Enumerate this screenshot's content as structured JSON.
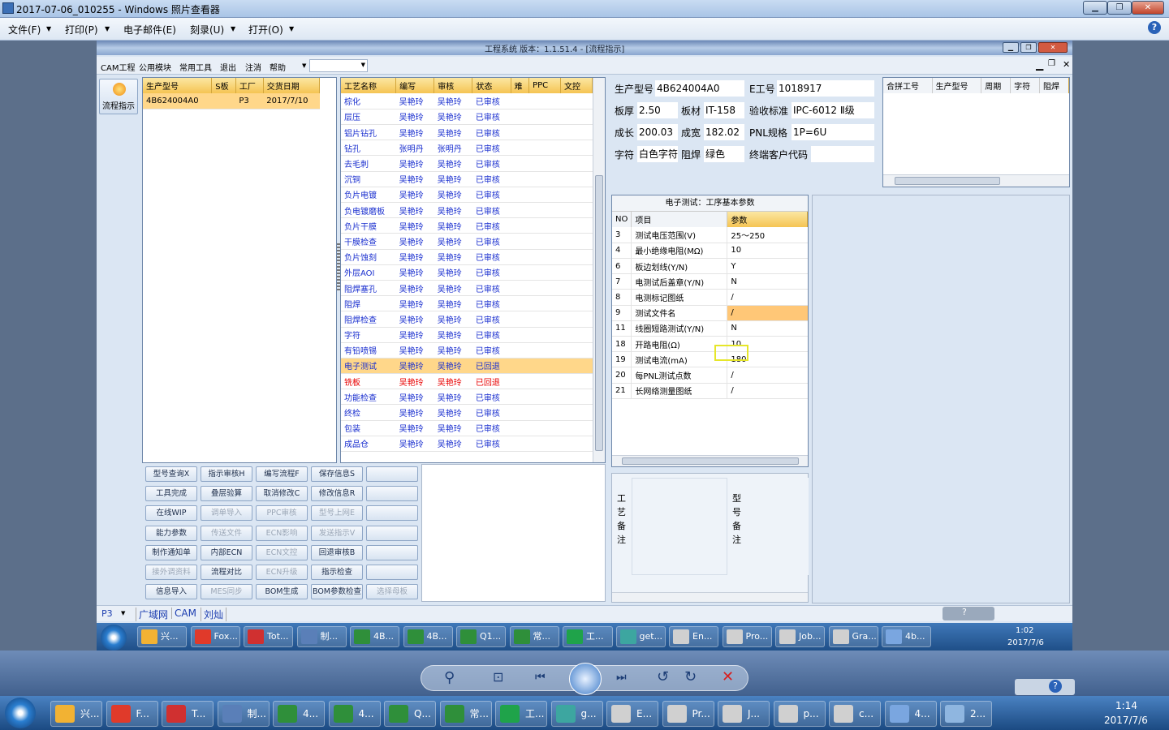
{
  "viewer": {
    "title": "2017-07-06_010255 - Windows 照片查看器",
    "menu": [
      "文件(F)",
      "打印(P)",
      "电子邮件(E)",
      "刻录(U)",
      "打开(O)"
    ]
  },
  "app": {
    "title": "工程系统   版本：1.1.51.4 - [流程指示]",
    "menu": [
      "CAM工程",
      "公用模块",
      "常用工具",
      "退出",
      "注消",
      "帮助"
    ],
    "side_button": "流程指示",
    "orders": {
      "headers": [
        "生产型号",
        "S板",
        "工厂",
        "交货日期"
      ],
      "rows": [
        [
          "4B624004A0",
          "",
          "P3",
          "2017/7/10"
        ]
      ]
    },
    "process": {
      "headers": [
        "工艺名称",
        "编写",
        "审核",
        "状态",
        "难",
        "PPC",
        "文控"
      ],
      "rows": [
        [
          "棕化",
          "吴艳玲",
          "吴艳玲",
          "已审核"
        ],
        [
          "层压",
          "吴艳玲",
          "吴艳玲",
          "已审核"
        ],
        [
          "铝片钻孔",
          "吴艳玲",
          "吴艳玲",
          "已审核"
        ],
        [
          "钻孔",
          "张明丹",
          "张明丹",
          "已审核"
        ],
        [
          "去毛刺",
          "吴艳玲",
          "吴艳玲",
          "已审核"
        ],
        [
          "沉铜",
          "吴艳玲",
          "吴艳玲",
          "已审核"
        ],
        [
          "负片电镀",
          "吴艳玲",
          "吴艳玲",
          "已审核"
        ],
        [
          "负电镀磨板",
          "吴艳玲",
          "吴艳玲",
          "已审核"
        ],
        [
          "负片干膜",
          "吴艳玲",
          "吴艳玲",
          "已审核"
        ],
        [
          "干膜检查",
          "吴艳玲",
          "吴艳玲",
          "已审核"
        ],
        [
          "负片蚀刻",
          "吴艳玲",
          "吴艳玲",
          "已审核"
        ],
        [
          "外层AOI",
          "吴艳玲",
          "吴艳玲",
          "已审核"
        ],
        [
          "阻焊塞孔",
          "吴艳玲",
          "吴艳玲",
          "已审核"
        ],
        [
          "阻焊",
          "吴艳玲",
          "吴艳玲",
          "已审核"
        ],
        [
          "阻焊检查",
          "吴艳玲",
          "吴艳玲",
          "已审核"
        ],
        [
          "字符",
          "吴艳玲",
          "吴艳玲",
          "已审核"
        ],
        [
          "有铅喷锡",
          "吴艳玲",
          "吴艳玲",
          "已审核"
        ],
        [
          "电子测试",
          "吴艳玲",
          "吴艳玲",
          "已回退"
        ],
        [
          "铣板",
          "吴艳玲",
          "吴艳玲",
          "已回退"
        ],
        [
          "功能检查",
          "吴艳玲",
          "吴艳玲",
          "已审核"
        ],
        [
          "终检",
          "吴艳玲",
          "吴艳玲",
          "已审核"
        ],
        [
          "包装",
          "吴艳玲",
          "吴艳玲",
          "已审核"
        ],
        [
          "成品仓",
          "吴艳玲",
          "吴艳玲",
          "已审核"
        ]
      ]
    },
    "buttons": [
      [
        "型号查询X",
        "指示审核H",
        "编写流程F",
        "保存信息S",
        ""
      ],
      [
        "工具完成",
        "叠层验算",
        "取消修改C",
        "修改信息R",
        ""
      ],
      [
        "在线WIP",
        "调单导入",
        "PPC审核",
        "型号上网E",
        ""
      ],
      [
        "能力参数",
        "传送文件",
        "ECN影响",
        "发送指示V",
        ""
      ],
      [
        "制作通知单",
        "内部ECN",
        "ECN文控",
        "回退审核B",
        ""
      ],
      [
        "接外调资料",
        "流程对比",
        "ECN升级",
        "指示检查",
        ""
      ],
      [
        "信息导入",
        "MES同步",
        "BOM生成",
        "BOM参数检查",
        "选择母板"
      ]
    ],
    "info": {
      "prod_model_label": "生产型号",
      "prod_model": "4B624004A0",
      "eno_label": "E工号",
      "eno": "1018917",
      "thick_label": "板厚",
      "thick": "2.50",
      "mat_label": "板材",
      "mat": "IT-158",
      "std_label": "验收标准",
      "std": "IPC-6012 Ⅱ级",
      "len_label": "成长",
      "len": "200.03",
      "wid_label": "成宽",
      "wid": "182.02",
      "pnl_label": "PNL规格",
      "pnl": "1P=6U",
      "char_label": "字符",
      "char": "白色字符",
      "mask_label": "阻焊",
      "mask": "绿色",
      "cust_label": "终端客户代码",
      "cust": ""
    },
    "merge": {
      "headers": [
        "合拼工号",
        "生产型号",
        "周期",
        "字符",
        "阻焊"
      ]
    },
    "params": {
      "title": "电子测试：工序基本参数",
      "headers": [
        "NO",
        "项目",
        "参数"
      ],
      "rows": [
        [
          "3",
          "测试电压范围(V)",
          "25～250"
        ],
        [
          "4",
          "最小绝缘电阻(MΩ)",
          "10"
        ],
        [
          "6",
          "板边划线(Y/N)",
          "Y"
        ],
        [
          "7",
          "电测试后盖章(Y/N)",
          "N"
        ],
        [
          "8",
          "电测标记图纸",
          "/"
        ],
        [
          "9",
          "测试文件名",
          "/"
        ],
        [
          "11",
          "线圈短路测试(Y/N)",
          "N"
        ],
        [
          "18",
          "开路电阻(Ω)",
          "10"
        ],
        [
          "19",
          "测试电流(mA)",
          "180"
        ],
        [
          "20",
          "每PNL测试点数",
          "/"
        ],
        [
          "21",
          "长网络测量图纸",
          "/"
        ]
      ]
    },
    "notes": {
      "craft": "工艺备注",
      "model": "型号备注"
    },
    "status": {
      "factory": "P3",
      "tabs": [
        "广域网",
        "CAM",
        "刘灿"
      ]
    }
  },
  "taskbar_inner": {
    "items": [
      "兴...",
      "Fox...",
      "Tot...",
      "制...",
      "4B...",
      "4B...",
      "Q1...",
      "常...",
      "工...",
      "get...",
      "En...",
      "Pro...",
      "Job...",
      "Gra...",
      "4b..."
    ],
    "time": "1:02",
    "date": "2017/7/6"
  },
  "taskbar_outer": {
    "items": [
      "兴...",
      "F...",
      "T...",
      "制...",
      "4...",
      "4...",
      "Q...",
      "常...",
      "工...",
      "g...",
      "E...",
      "Pr...",
      "J...",
      "p...",
      "c...",
      "4...",
      "2..."
    ],
    "time": "1:14",
    "date": "2017/7/6"
  }
}
